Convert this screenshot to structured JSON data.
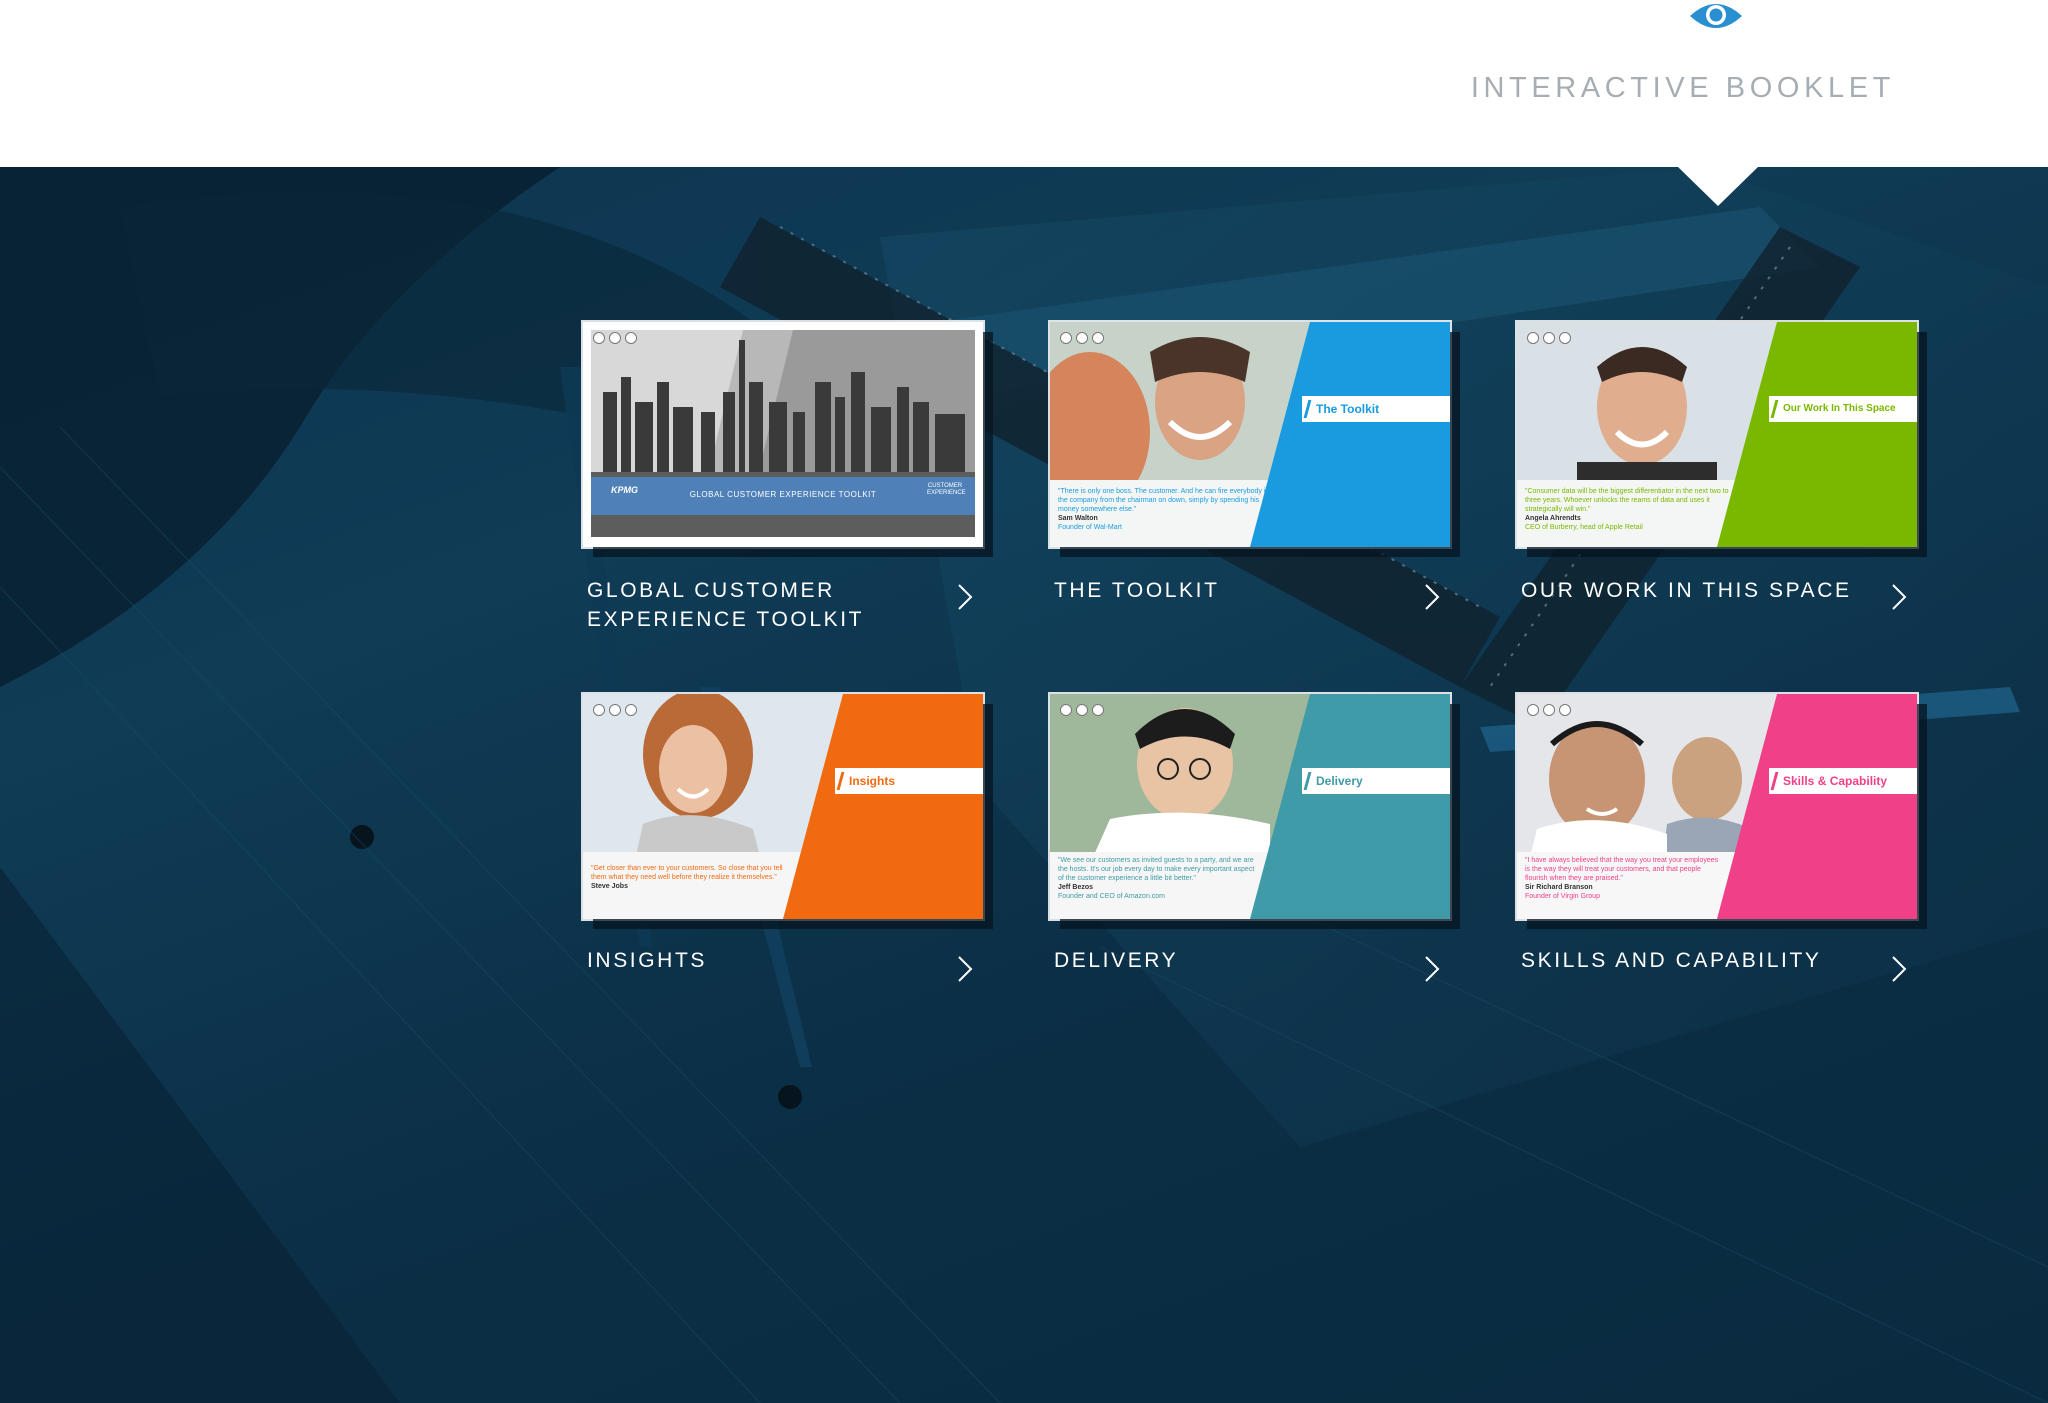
{
  "header": {
    "booklet_label": "INTERACTIVE BOOKLET",
    "icon": "eye-icon"
  },
  "colors": {
    "accent": "#2a8fd0",
    "background": "#0e3550",
    "toolkit": "#1a9be0",
    "our_work": "#7ab800",
    "insights": "#f26a10",
    "delivery": "#3f9ba8",
    "skills": "#f04088",
    "cover_band": "#4f80b8"
  },
  "tiles": [
    {
      "title_line1": "GLOBAL CUSTOMER",
      "title_line2": "EXPERIENCE TOOLKIT",
      "thumb_brand": "KPMG",
      "thumb_title": "GLOBAL CUSTOMER EXPERIENCE TOOLKIT",
      "thumb_logo": "CUSTOMER EXPERIENCE"
    },
    {
      "title": "THE TOOLKIT",
      "banner": "The Toolkit",
      "quote": "\"There is only one boss. The customer. And he can fire everybody in the company from the chairman on down, simply by spending his money somewhere else.\"",
      "author": "Sam Walton",
      "role": "Founder of Wal-Mart"
    },
    {
      "title": "OUR WORK IN THIS SPACE",
      "banner": "Our Work In This Space",
      "quote": "\"Consumer data will be the biggest differentiator in the next two to three years. Whoever unlocks the reams of data and uses it strategically will win.\"",
      "author": "Angela Ahrendts",
      "role": "CEO of Burberry, head of Apple Retail"
    },
    {
      "title": "INSIGHTS",
      "banner": "Insights",
      "quote": "\"Get closer than ever to your customers. So close that you tell them what they need well before they realize it themselves.\"",
      "author": "Steve Jobs",
      "role": ""
    },
    {
      "title": "DELIVERY",
      "banner": "Delivery",
      "quote": "\"We see our customers as invited guests to a party, and we are the hosts. It's our job every day to make every important aspect of the customer experience a little bit better.\"",
      "author": "Jeff Bezos",
      "role": "Founder and CEO of Amazon.com"
    },
    {
      "title": "SKILLS AND CAPABILITY",
      "banner": "Skills & Capability",
      "quote": "\"I have always believed that the way you treat your employees is the way they will treat your customers, and that people flourish when they are praised.\"",
      "author": "Sir Richard Branson",
      "role": "Founder of Virgin Group"
    }
  ]
}
